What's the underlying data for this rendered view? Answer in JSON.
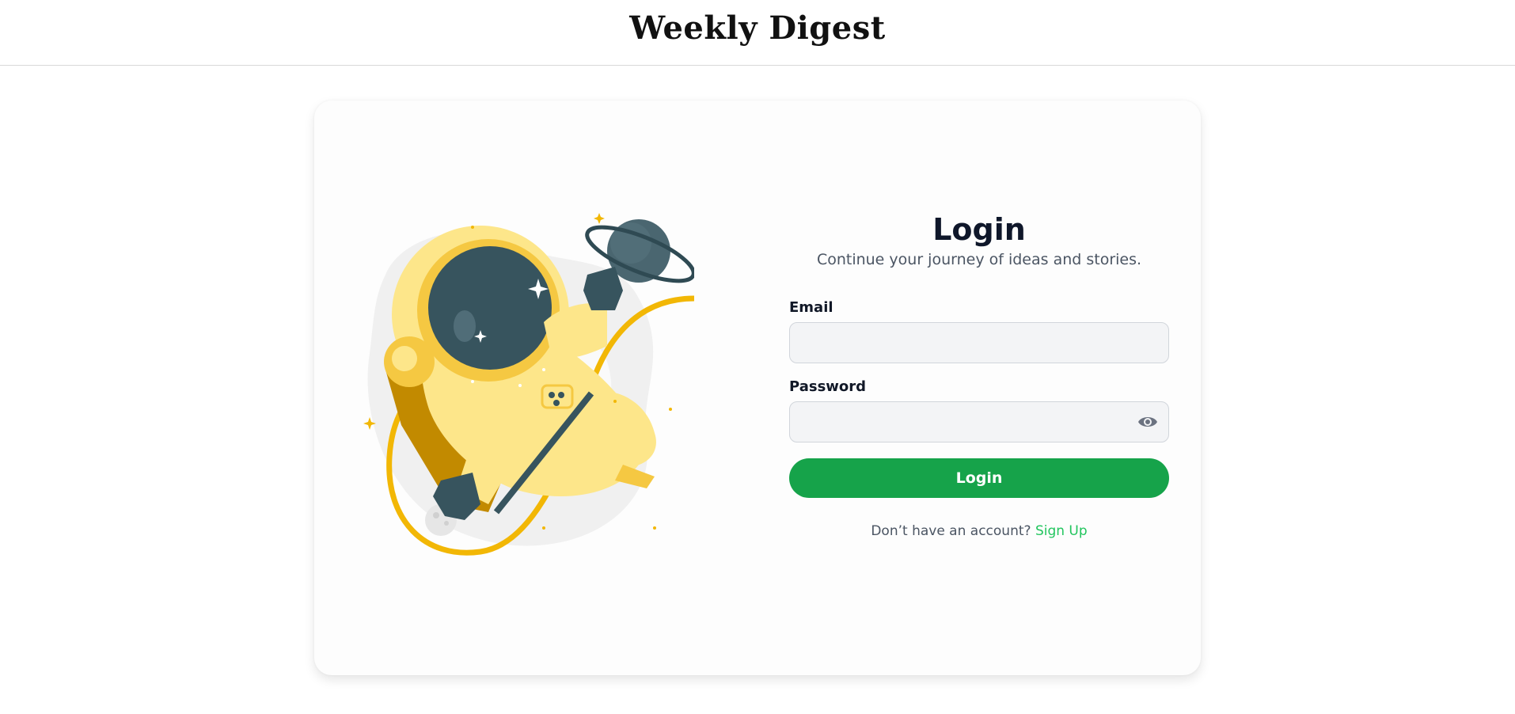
{
  "header": {
    "brand": "Weekly Digest"
  },
  "login": {
    "title": "Login",
    "subtitle": "Continue your journey of ideas and stories.",
    "email_label": "Email",
    "email_value": "",
    "email_placeholder": "",
    "password_label": "Password",
    "password_value": "",
    "password_placeholder": "",
    "password_toggle_icon": "eye-icon",
    "submit_label": "Login",
    "signup_prompt": "Don’t have an account?",
    "signup_link": "Sign Up"
  },
  "colors": {
    "accent": "#16a34a",
    "link": "#22c55e",
    "suit_yellow": "#fde68a",
    "suit_dark": "#c28a00",
    "helmet": "#37545e",
    "tether": "#f2b705"
  }
}
